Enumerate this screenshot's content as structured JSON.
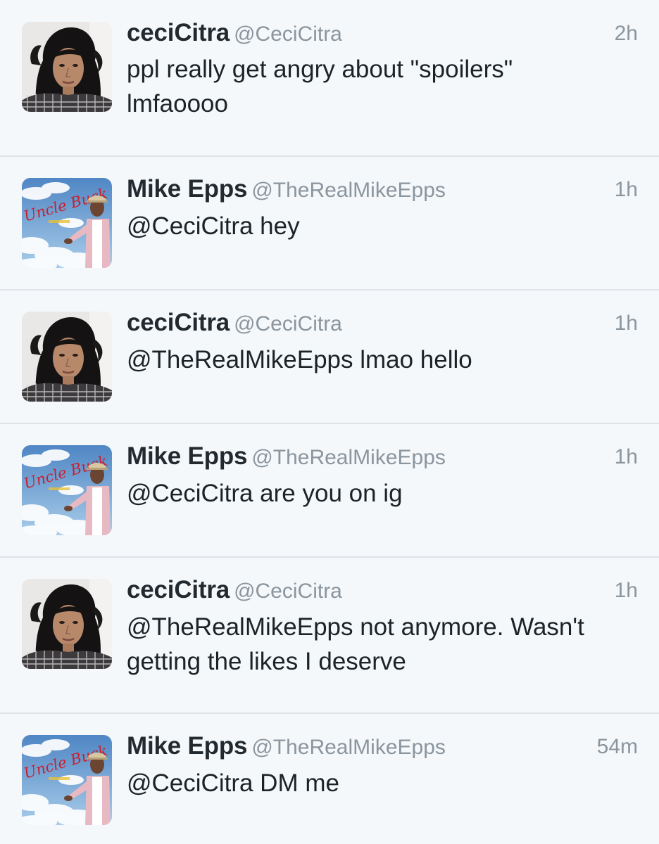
{
  "tweets": [
    {
      "name": "ceciCitra",
      "handle": "@CeciCitra",
      "time": "2h",
      "text": "ppl really get angry about \"spoilers\" lmfaoooo",
      "avatar_icon": "ceci-portrait-avatar"
    },
    {
      "name": "Mike Epps",
      "handle": "@TheRealMikeEpps",
      "time": "1h",
      "text": "@CeciCitra hey",
      "avatar_icon": "uncle-buck-avatar"
    },
    {
      "name": "ceciCitra",
      "handle": "@CeciCitra",
      "time": "1h",
      "text": "@TheRealMikeEpps lmao hello",
      "avatar_icon": "ceci-portrait-avatar"
    },
    {
      "name": "Mike Epps",
      "handle": "@TheRealMikeEpps",
      "time": "1h",
      "text": "@CeciCitra are you on ig",
      "avatar_icon": "uncle-buck-avatar"
    },
    {
      "name": "ceciCitra",
      "handle": "@CeciCitra",
      "time": "1h",
      "text": "@TheRealMikeEpps not anymore. Wasn't getting the likes I deserve",
      "avatar_icon": "ceci-portrait-avatar"
    },
    {
      "name": "Mike Epps",
      "handle": "@TheRealMikeEpps",
      "time": "54m",
      "text": "@CeciCitra DM me",
      "avatar_icon": "uncle-buck-avatar"
    }
  ],
  "avatar_art_text": {
    "uncle_buck": "Uncle Buck"
  },
  "colors": {
    "background": "#f5f8fa",
    "divider": "#dfe3e8",
    "name": "#222a30",
    "meta": "#8a959e",
    "text": "#1c2327"
  }
}
